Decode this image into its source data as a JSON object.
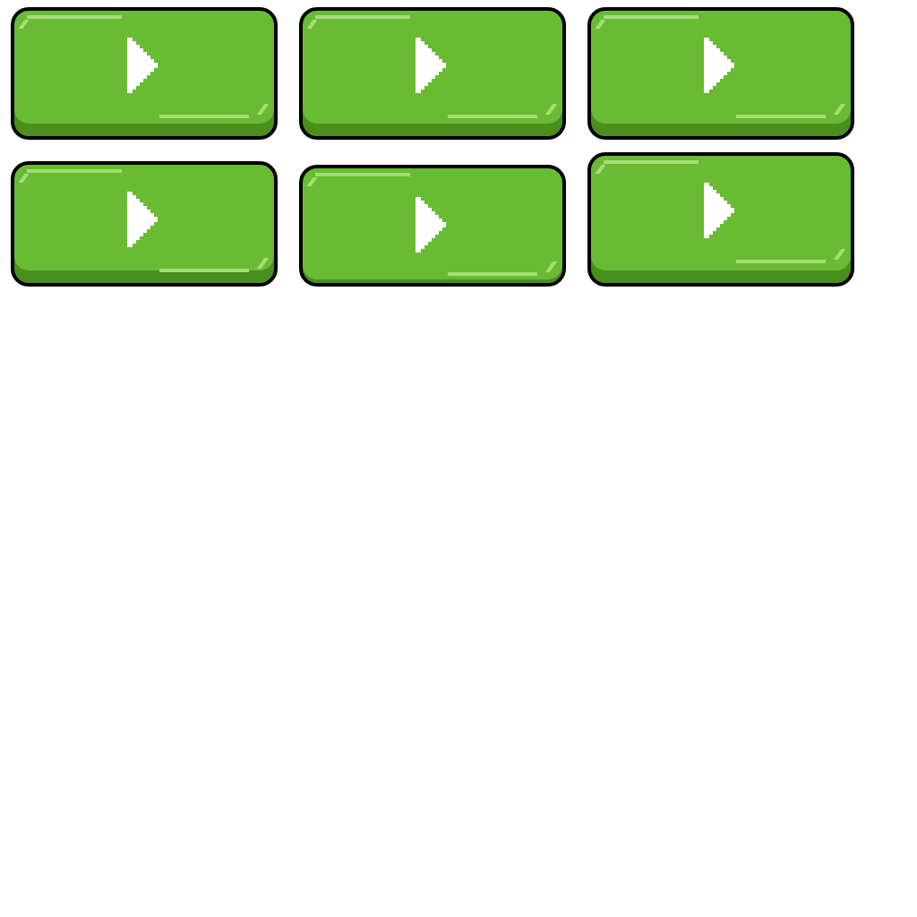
{
  "sprite_sheet": {
    "colors": {
      "outline": "#000000",
      "face": "#69bb33",
      "shade": "#4a8f1c",
      "shine": "#a7dd78",
      "icon": "#ffffff",
      "background": "#ffffff"
    },
    "buttons": [
      {
        "name": "play-button-1",
        "icon": "play-icon",
        "state": "normal"
      },
      {
        "name": "play-button-2",
        "icon": "play-icon",
        "state": "normal"
      },
      {
        "name": "play-button-3",
        "icon": "play-icon",
        "state": "normal"
      },
      {
        "name": "play-button-4",
        "icon": "play-icon",
        "state": "normal"
      },
      {
        "name": "play-button-5",
        "icon": "play-icon",
        "state": "pressed"
      },
      {
        "name": "play-button-6",
        "icon": "play-icon",
        "state": "hover"
      }
    ]
  }
}
